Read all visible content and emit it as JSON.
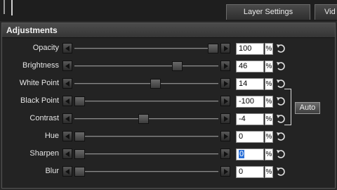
{
  "tabs": [
    {
      "label": "Layer Settings"
    },
    {
      "label": "Vid"
    }
  ],
  "panel": {
    "title": "Adjustments"
  },
  "auto_label": "Auto",
  "adjustments": [
    {
      "label": "Opacity",
      "value": "100",
      "unit": "%",
      "level": 1.0
    },
    {
      "label": "Brightness",
      "value": "46",
      "unit": "%",
      "level": 0.73
    },
    {
      "label": "White Point",
      "value": "14",
      "unit": "%",
      "level": 0.57
    },
    {
      "label": "Black Point",
      "value": "-100",
      "unit": "%",
      "level": 0.0
    },
    {
      "label": "Contrast",
      "value": "-4",
      "unit": "%",
      "level": 0.48
    },
    {
      "label": "Hue",
      "value": "0",
      "unit": "%",
      "level": 0.0
    },
    {
      "label": "Sharpen",
      "value": "0",
      "unit": "%",
      "level": 0.0,
      "selected": true
    },
    {
      "label": "Blur",
      "value": "0",
      "unit": "%",
      "level": 0.0
    }
  ],
  "icons": {
    "left_arrow": "triangle-left-icon",
    "right_arrow": "triangle-right-icon",
    "reset": "reset-icon"
  }
}
